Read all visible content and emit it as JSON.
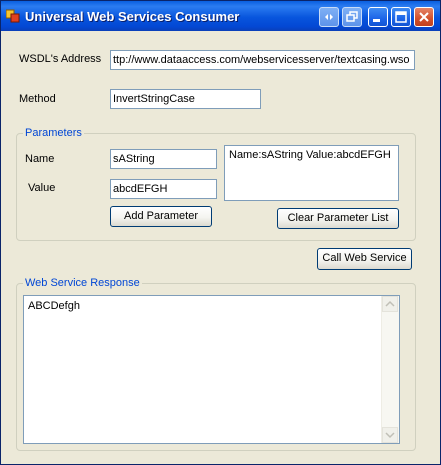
{
  "window": {
    "title": "Universal Web Services Consumer"
  },
  "form": {
    "wsdl_label": "WSDL's Address",
    "wsdl_value": "ttp://www.dataaccess.com/webservicesserver/textcasing.wso",
    "method_label": "Method",
    "method_value": "InvertStringCase"
  },
  "parameters": {
    "group_title": "Parameters",
    "name_label": "Name",
    "name_value": "sAString",
    "value_label": "Value",
    "value_value": "abcdEFGH",
    "add_button": "Add Parameter",
    "list_items": [
      "Name:sAString Value:abcdEFGH"
    ],
    "clear_button": "Clear Parameter List"
  },
  "call_button": "Call Web Service",
  "response": {
    "group_title": "Web Service Response",
    "text": "ABCDefgh"
  },
  "icons": {
    "app": "app-icon",
    "help": "help-icon",
    "restore": "restore-icon",
    "minimize": "minimize-icon",
    "maximize": "maximize-icon",
    "close": "close-icon"
  },
  "colors": {
    "titlebar": "#0855dd",
    "group_title": "#0046d5",
    "close_button": "#d2502c"
  }
}
